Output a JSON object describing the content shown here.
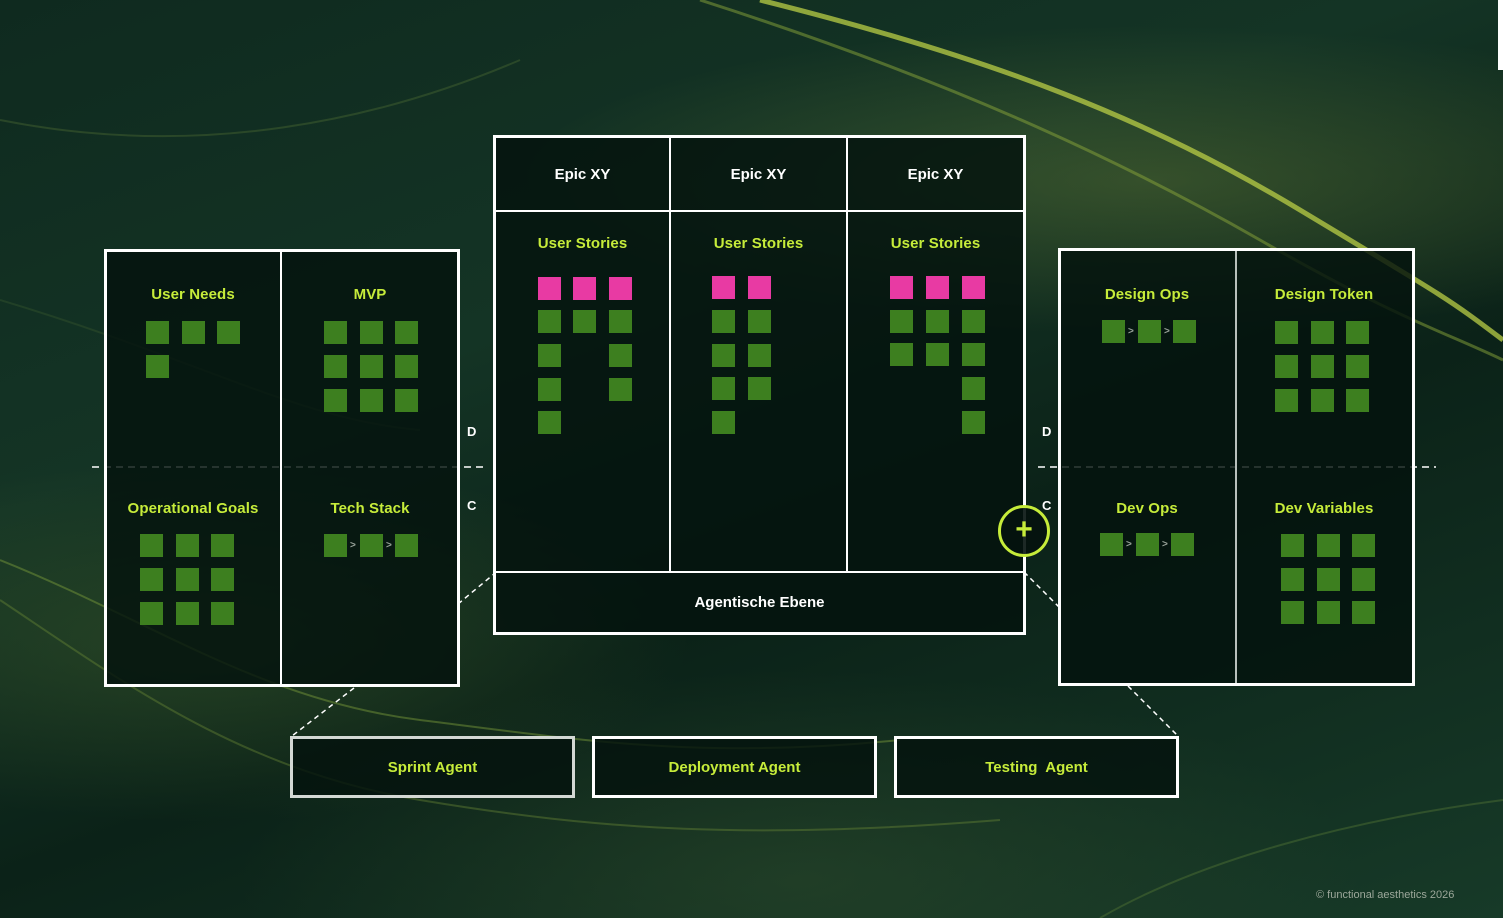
{
  "left_panel": {
    "quadrants": {
      "top_left": "User Needs",
      "top_right": "MVP",
      "bottom_left": "Operational Goals",
      "bottom_right": "Tech Stack"
    },
    "marker_d": "D",
    "marker_c": "C"
  },
  "center_panel": {
    "epics": [
      "Epic XY",
      "Epic XY",
      "Epic XY"
    ],
    "stories_labels": [
      "User Stories",
      "User Stories",
      "User Stories"
    ],
    "footer": "Agentische Ebene"
  },
  "right_panel": {
    "quadrants": {
      "top_left": "Design Ops",
      "top_right": "Design Token",
      "bottom_left": "Dev Ops",
      "bottom_right": "Dev Variables"
    },
    "marker_d": "D",
    "marker_c": "C"
  },
  "agents": [
    "Sprint Agent",
    "Deployment Agent",
    "Testing  Agent"
  ],
  "add_button": {
    "symbol": "+",
    "icon": "plus-icon"
  },
  "copyright": "© functional aesthetics 2026",
  "colors": {
    "accent": "#c6ec3a",
    "task_green": "#3d7f1f",
    "task_pink": "#e83aa3",
    "border": "#ffffff"
  }
}
